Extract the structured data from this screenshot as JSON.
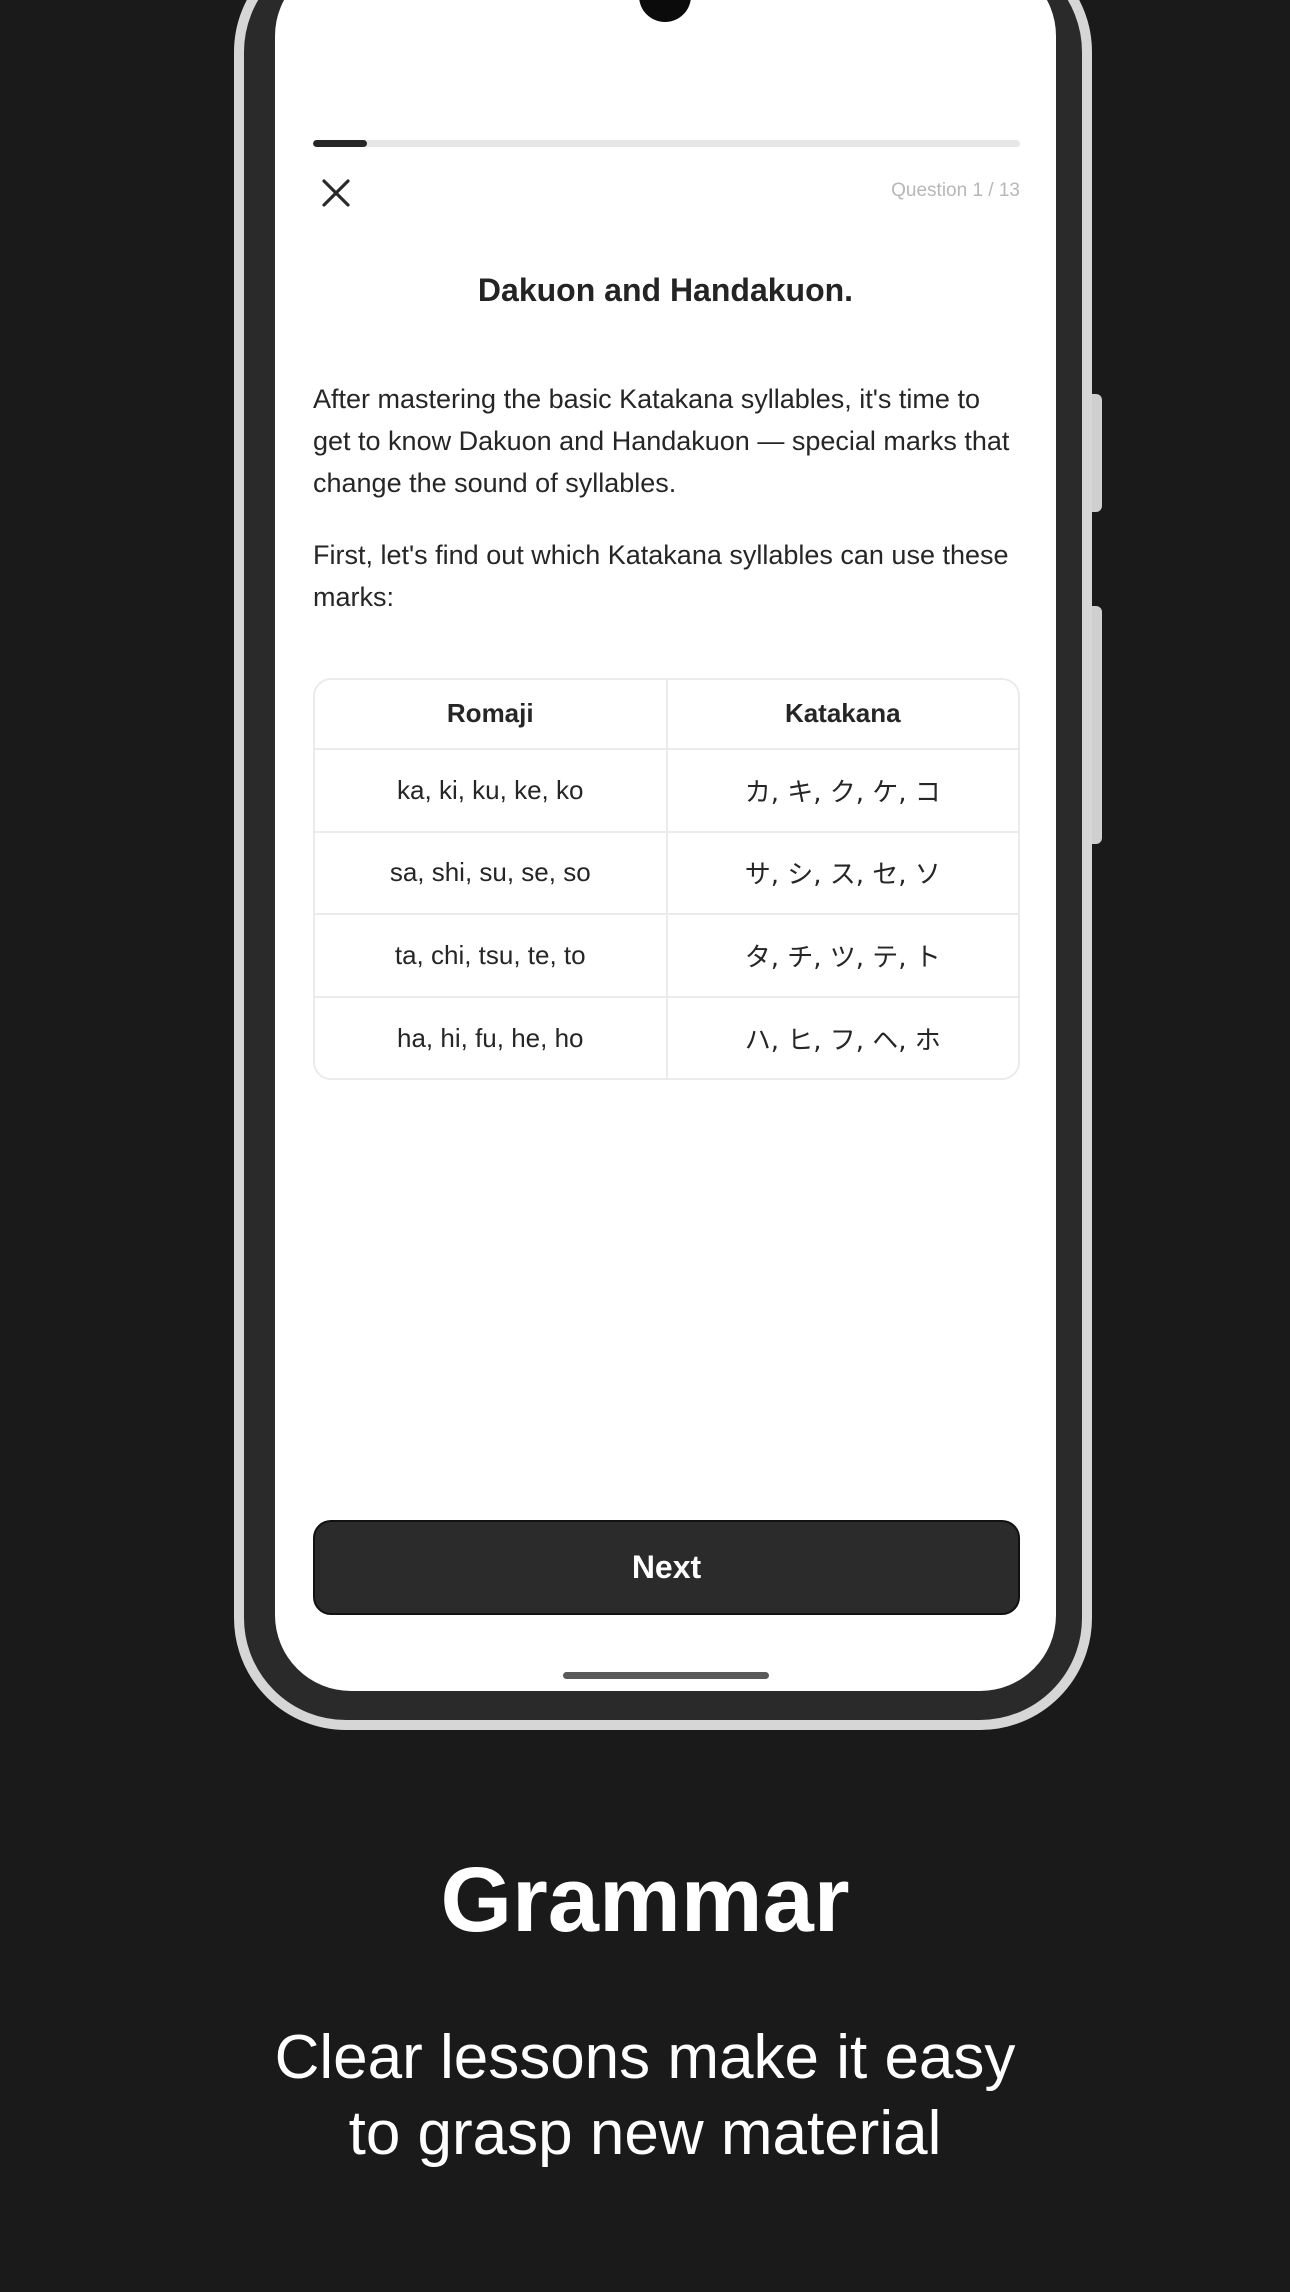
{
  "lesson": {
    "progress": 0.077,
    "question_counter": "Question 1 / 13",
    "title": "Dakuon and Handakuon.",
    "paragraphs": [
      "After mastering the basic Katakana syllables, it's time to get to know Dakuon and Handakuon — special marks that change the sound of syllables.",
      "First, let's find out which Katakana syllables can use these marks:"
    ],
    "table": {
      "headers": [
        "Romaji",
        "Katakana"
      ],
      "rows": [
        [
          "ka, ki, ku, ke, ko",
          "カ, キ, ク, ケ, コ"
        ],
        [
          "sa, shi, su, se, so",
          "サ, シ, ス, セ, ソ"
        ],
        [
          "ta, chi, tsu, te, to",
          "タ, チ, ツ, テ, ト"
        ],
        [
          "ha, hi, fu, he, ho",
          "ハ, ヒ, フ, ヘ, ホ"
        ]
      ]
    },
    "next_label": "Next"
  },
  "caption": {
    "title": "Grammar",
    "subtitle_lines": [
      "Clear lessons make it easy",
      "to grasp new material"
    ]
  },
  "icons": {
    "close": "close-icon",
    "camera": "camera-icon"
  },
  "colors": {
    "background": "#1a1a1a",
    "button": "#2b2b2b",
    "progress": "#262626"
  }
}
